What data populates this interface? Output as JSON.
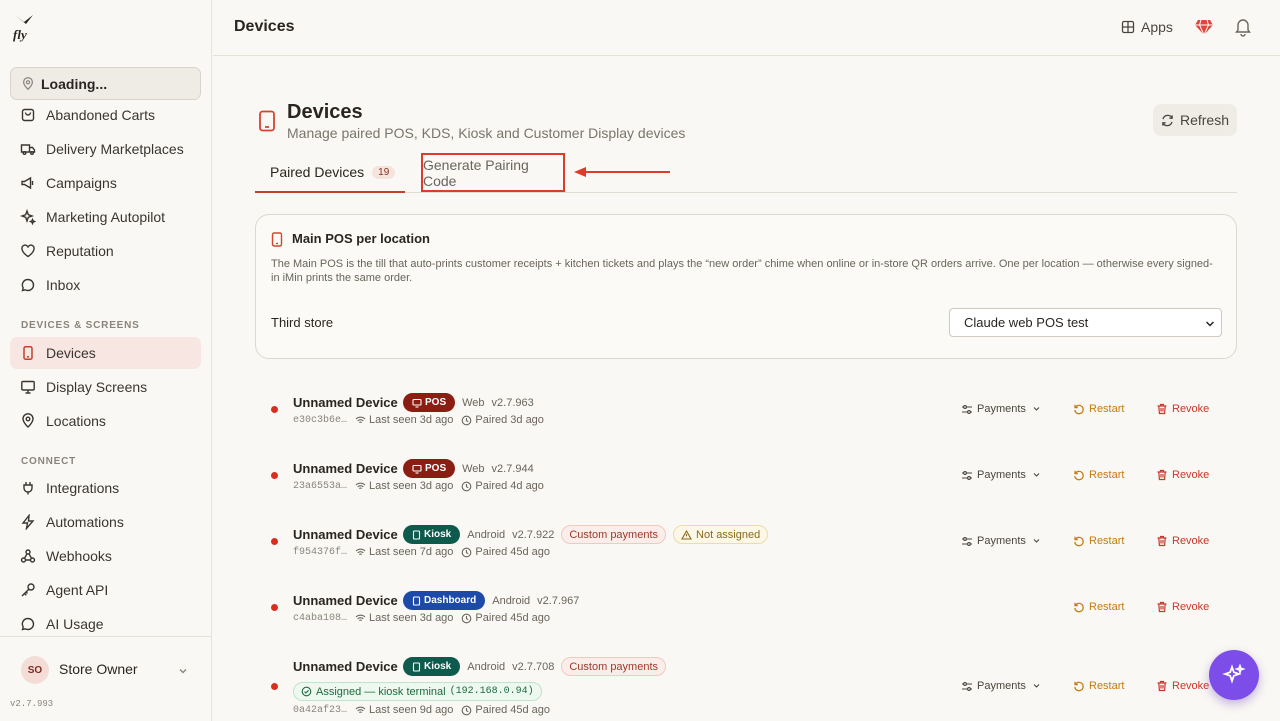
{
  "sidebar": {
    "location_selector": "Loading...",
    "items": [
      {
        "label": "Abandoned Carts",
        "icon": "cart-icon"
      },
      {
        "label": "Delivery Marketplaces",
        "icon": "truck-icon"
      },
      {
        "label": "Campaigns",
        "icon": "megaphone-icon"
      },
      {
        "label": "Marketing Autopilot",
        "icon": "sparkle-icon"
      },
      {
        "label": "Reputation",
        "icon": "heart-icon"
      },
      {
        "label": "Inbox",
        "icon": "chat-icon"
      }
    ],
    "section_devices": "DEVICES & SCREENS",
    "devices_items": [
      {
        "label": "Devices",
        "icon": "tablet-icon",
        "active": true
      },
      {
        "label": "Display Screens",
        "icon": "monitor-icon"
      },
      {
        "label": "Locations",
        "icon": "pin-icon"
      }
    ],
    "section_connect": "CONNECT",
    "connect_items": [
      {
        "label": "Integrations",
        "icon": "plug-icon"
      },
      {
        "label": "Automations",
        "icon": "bolt-icon"
      },
      {
        "label": "Webhooks",
        "icon": "webhook-icon"
      },
      {
        "label": "Agent API",
        "icon": "key-icon"
      },
      {
        "label": "AI Usage",
        "icon": "chat-icon"
      }
    ],
    "user": {
      "initials": "SO",
      "name": "Store Owner"
    },
    "version": "v2.7.993"
  },
  "topbar": {
    "title": "Devices",
    "apps_label": "Apps"
  },
  "page": {
    "title": "Devices",
    "subtitle": "Manage paired POS, KDS, Kiosk and Customer Display devices",
    "refresh_label": "Refresh"
  },
  "tabs": {
    "paired_label": "Paired Devices",
    "paired_count": "19",
    "generate_label": "Generate Pairing Code"
  },
  "main_pos": {
    "title": "Main POS per location",
    "description": "The Main POS is the till that auto-prints customer receipts + kitchen tickets and plays the “new order” chime when online or in-store QR orders arrive. One per location — otherwise every signed-in iMin prints the same order.",
    "store_label": "Third store",
    "selected_pos": "Claude web POS test"
  },
  "devices": [
    {
      "name": "Unnamed Device",
      "type": "POS",
      "platform": "Web",
      "version": "v2.7.963",
      "id": "e30c3b6e…",
      "last_seen": "Last seen 3d ago",
      "paired": "Paired 3d ago",
      "payments": "Payments",
      "restart": "Restart",
      "revoke": "Revoke"
    },
    {
      "name": "Unnamed Device",
      "type": "POS",
      "platform": "Web",
      "version": "v2.7.944",
      "id": "23a6553a…",
      "last_seen": "Last seen 3d ago",
      "paired": "Paired 4d ago",
      "payments": "Payments",
      "restart": "Restart",
      "revoke": "Revoke"
    },
    {
      "name": "Unnamed Device",
      "type": "Kiosk",
      "platform": "Android",
      "version": "v2.7.922",
      "custom": "Custom payments",
      "warning": "Not assigned",
      "id": "f954376f…",
      "last_seen": "Last seen 7d ago",
      "paired": "Paired 45d ago",
      "payments": "Payments",
      "restart": "Restart",
      "revoke": "Revoke"
    },
    {
      "name": "Unnamed Device",
      "type": "Dashboard",
      "platform": "Android",
      "version": "v2.7.967",
      "id": "c4aba108…",
      "last_seen": "Last seen 3d ago",
      "paired": "Paired 45d ago",
      "restart": "Restart",
      "revoke": "Revoke"
    },
    {
      "name": "Unnamed Device",
      "type": "Kiosk",
      "platform": "Android",
      "version": "v2.7.708",
      "custom": "Custom payments",
      "assigned": "Assigned — kiosk terminal",
      "assigned_ip": "(192.168.0.94)",
      "id": "0a42af23…",
      "last_seen": "Last seen 9d ago",
      "paired": "Paired 45d ago",
      "payments": "Payments",
      "restart": "Restart",
      "revoke": "Revoke"
    }
  ],
  "colors": {
    "accent": "#c2412d",
    "pos_badge": "#8b1d12",
    "kiosk_badge": "#0e5a4c",
    "dashboard_badge": "#1d4aa8",
    "restart": "#c47a10",
    "revoke": "#c8372a",
    "fab": "#7c4de8"
  }
}
